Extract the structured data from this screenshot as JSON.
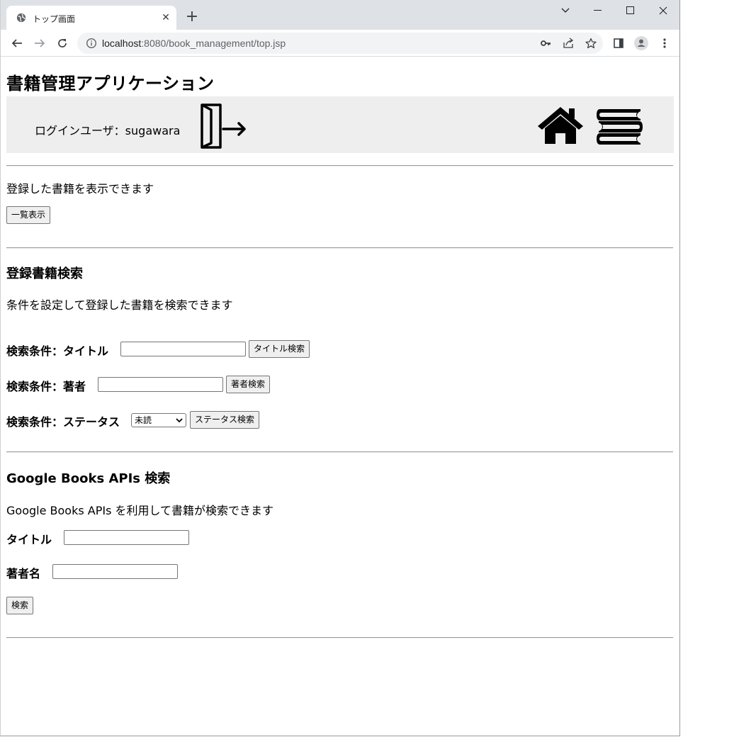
{
  "browser": {
    "tab_title": "トップ画面",
    "tab_close": "✕",
    "new_tab": "+",
    "url_host": "localhost",
    "url_rest": ":8080/book_management/top.jsp"
  },
  "page": {
    "app_title": "書籍管理アプリケーション",
    "header": {
      "login_user_text": "ログインユーザ：sugawara"
    },
    "list_section": {
      "description": "登録した書籍を表示できます",
      "list_button": "一覧表示"
    },
    "search_section": {
      "heading": "登録書籍検索",
      "description": "条件を設定して登録した書籍を検索できます",
      "title_label": "検索条件：タイトル",
      "title_value": "",
      "title_button": "タイトル検索",
      "author_label": "検索条件：著者",
      "author_value": "",
      "author_button": "著者検索",
      "status_label": "検索条件：ステータス",
      "status_selected": "未読",
      "status_button": "ステータス検索"
    },
    "google_section": {
      "heading": "Google Books APIs 検索",
      "description": "Google Books APIs を利用して書籍が検索できます",
      "title_label": "タイトル",
      "title_value": "",
      "author_label": "著者名",
      "author_value": "",
      "search_button": "検索"
    }
  }
}
